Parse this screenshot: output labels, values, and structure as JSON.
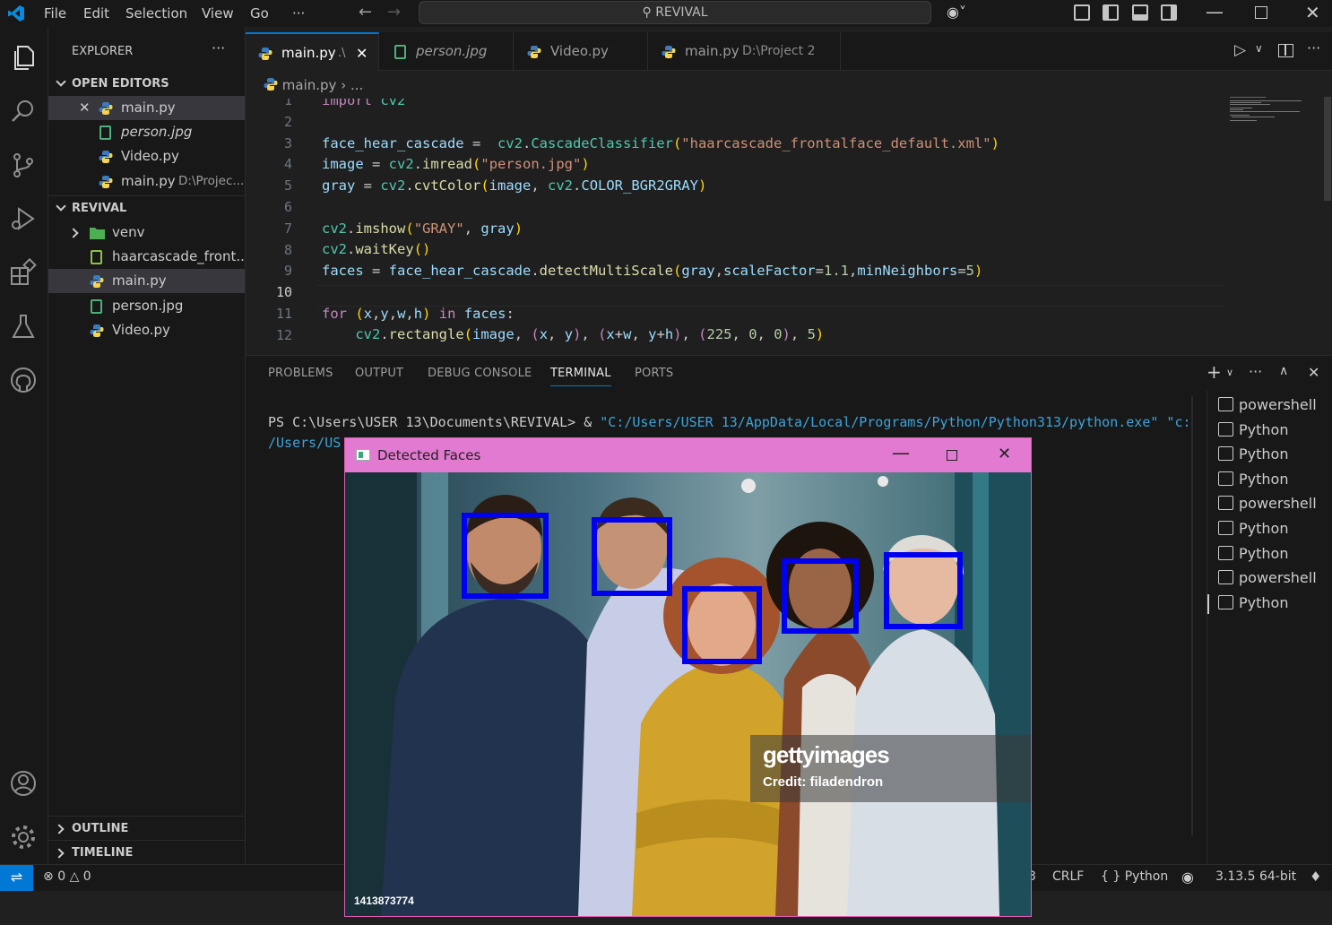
{
  "titlebar": {
    "menus": [
      "File",
      "Edit",
      "Selection",
      "View",
      "Go",
      "···"
    ],
    "search": "REVIVAL"
  },
  "sidebar": {
    "title": "EXPLORER",
    "open_editors_label": "OPEN EDITORS",
    "open_editors": [
      {
        "name": "main.py",
        "path": ""
      },
      {
        "name": "person.jpg",
        "path": ""
      },
      {
        "name": "Video.py",
        "path": ""
      },
      {
        "name": "main.py",
        "path": "D:\\Projec..."
      }
    ],
    "folder_label": "REVIVAL",
    "files": [
      "venv",
      "haarcascade_front...",
      "main.py",
      "person.jpg",
      "Video.py"
    ],
    "outline_label": "OUTLINE",
    "timeline_label": "TIMELINE"
  },
  "tabs": [
    {
      "name": "main.py",
      "path": ".\\"
    },
    {
      "name": "person.jpg",
      "path": ""
    },
    {
      "name": "Video.py",
      "path": ""
    },
    {
      "name": "main.py",
      "path": "D:\\Project 2"
    }
  ],
  "breadcrumb": {
    "file": "main.py",
    "rest": "..."
  },
  "editor": {
    "current_line": 10,
    "line_numbers": [
      "1",
      "2",
      "3",
      "4",
      "5",
      "6",
      "7",
      "8",
      "9",
      "10",
      "11",
      "12"
    ]
  },
  "panel": {
    "tabs": [
      "PROBLEMS",
      "OUTPUT",
      "DEBUG CONSOLE",
      "TERMINAL",
      "PORTS"
    ],
    "active_tab": "TERMINAL",
    "terminal_line1_prompt": "PS C:\\Users\\USER 13\\Documents\\REVIVAL> & ",
    "terminal_line1_path": "\"C:/Users/USER 13/AppData/Local/Programs/Python/Python313/python.exe\" \"c:",
    "terminal_line2": "/Users/US",
    "terminals": [
      "powershell",
      "Python",
      "Python",
      "Python",
      "powershell",
      "Python",
      "Python",
      "powershell",
      "Python"
    ]
  },
  "status": {
    "errors": "0",
    "warnings": "0",
    "eol": "CRLF",
    "language": "Python",
    "interpreter": "3.13.5 64-bit",
    "partial": "3"
  },
  "cv_window": {
    "title": "Detected Faces",
    "watermark_brand": "gettyimages",
    "watermark_credit": "Credit: filadendron",
    "image_id": "1413873774",
    "faces_detected": 5
  },
  "colors": {
    "accent": "#0078d4",
    "face_box": "#0000f0",
    "cv_titlebar": "#e17ad0"
  }
}
